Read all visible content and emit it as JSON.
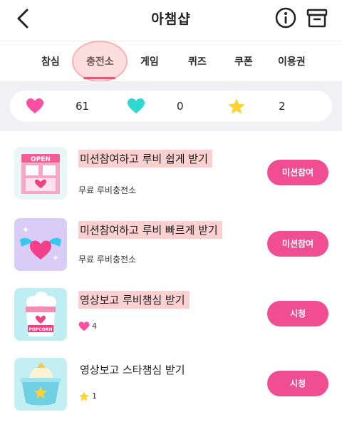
{
  "header": {
    "title": "아챔샵",
    "back_icon": "chevron-left-icon",
    "info_icon": "info-icon",
    "archive_icon": "archive-box-icon"
  },
  "tabs": [
    {
      "label": "참심"
    },
    {
      "label": "충전소",
      "active": true
    },
    {
      "label": "게임"
    },
    {
      "label": "퀴즈"
    },
    {
      "label": "쿠폰"
    },
    {
      "label": "이용권"
    }
  ],
  "stats": {
    "heart": {
      "icon": "pink-heart-icon",
      "value": "61",
      "color": "#ff4fa0"
    },
    "mint_heart": {
      "icon": "mint-heart-icon",
      "value": "0",
      "color": "#2fd8d0"
    },
    "star": {
      "icon": "star-icon",
      "value": "2",
      "color": "#ffd335"
    }
  },
  "items": [
    {
      "title": "미션참여하고 루비 쉽게 받기",
      "subtitle": "무료 루비충전소",
      "button": "미션참여",
      "thumb_icon": "open-shop-icon",
      "thumb_text": "OPEN"
    },
    {
      "title": "미션참여하고 루비 빠르게 받기",
      "subtitle": "무료 루비충전소",
      "button": "미션참여",
      "thumb_icon": "winged-heart-icon"
    },
    {
      "title": "영상보고 루비챔심 받기",
      "reward_icon": "pink-heart-icon",
      "reward_value": "4",
      "button": "시청",
      "thumb_icon": "popcorn-icon",
      "thumb_text": "POPCORN"
    },
    {
      "title": "영상보고 스타챔심 받기",
      "reward_icon": "star-icon",
      "reward_value": "1",
      "button": "시청",
      "thumb_icon": "ice-cream-star-icon"
    }
  ],
  "colors": {
    "accent": "#f04d93",
    "highlight": "#f6aaaa",
    "stats_bg": "#f1f1f3"
  }
}
